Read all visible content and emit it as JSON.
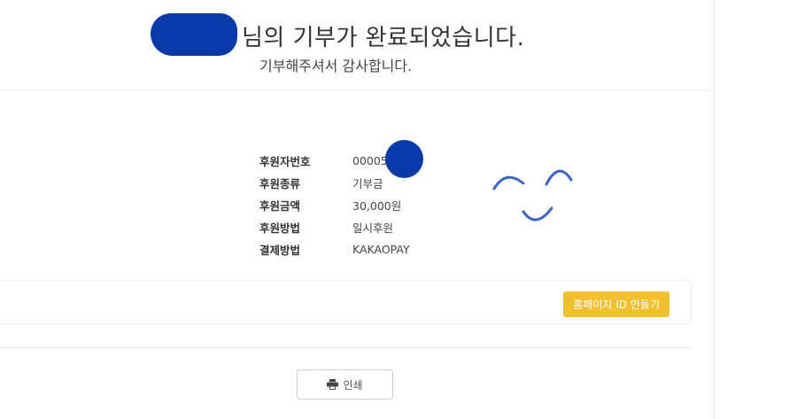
{
  "header": {
    "title_suffix": "님의 기부가 완료되었습니다.",
    "subtitle": "기부해주셔서 감사합니다."
  },
  "donation_info": [
    {
      "label": "후원자번호",
      "value": "00005"
    },
    {
      "label": "후원종류",
      "value": "기부금"
    },
    {
      "label": "후원금액",
      "value": "30,000원"
    },
    {
      "label": "후원방법",
      "value": "일시후원"
    },
    {
      "label": "결제방법",
      "value": "KAKAOPAY"
    }
  ],
  "promo": {
    "button_label": "홈페이지 ID 만들기"
  },
  "footer": {
    "print_label": "인쇄"
  },
  "colors": {
    "accent_yellow": "#f0c02f",
    "redaction_blue": "#0a3aa8"
  },
  "icons": {
    "print": "printer-icon"
  }
}
